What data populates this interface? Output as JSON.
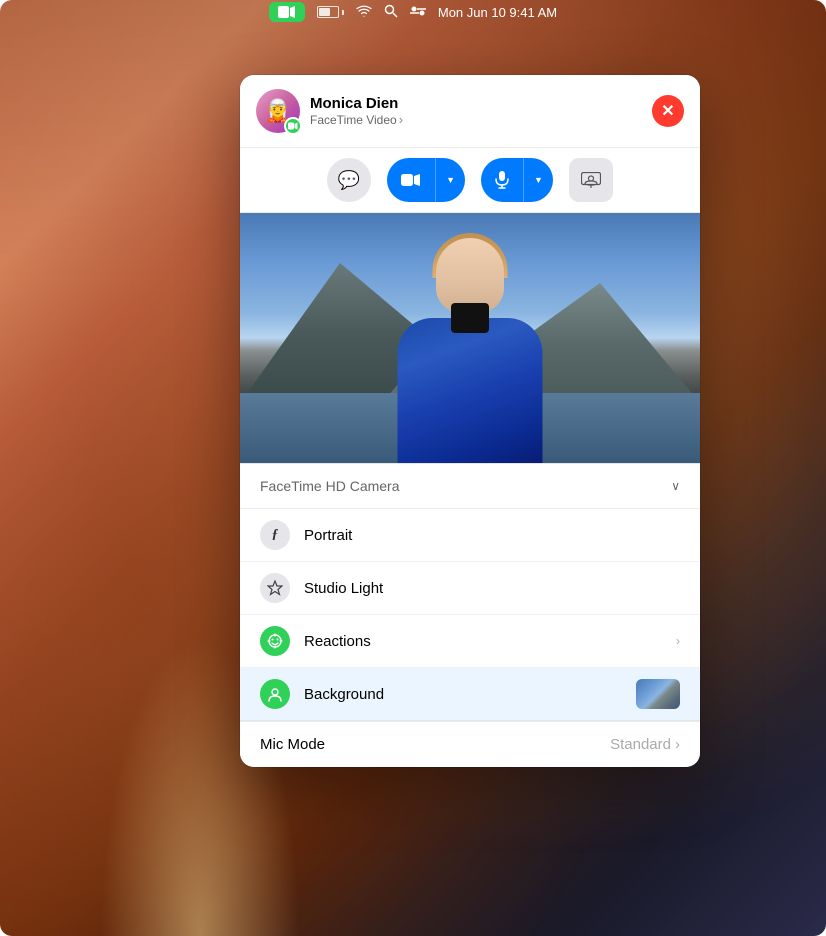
{
  "desktop": {
    "bg_description": "macOS Monterey warm gradient desktop background"
  },
  "menubar": {
    "time": "Mon Jun 10  9:41 AM",
    "facetime_icon": "▶",
    "wifi_icon": "wifi",
    "search_icon": "search",
    "control_icon": "control-center"
  },
  "facetime_window": {
    "caller_name": "Monica Dien",
    "caller_subtitle": "FaceTime Video",
    "caller_subtitle_chevron": "›",
    "avatar_emoji": "🧝",
    "close_label": "×",
    "controls": {
      "message_icon": "💬",
      "video_icon": "📹",
      "mic_icon": "🎤",
      "screen_icon": "👤",
      "chevron_down": "∨"
    },
    "camera_section": {
      "label": "FaceTime HD Camera",
      "chevron": "∨"
    },
    "menu_items": [
      {
        "id": "portrait",
        "icon": "ƒ",
        "icon_style": "gray",
        "label": "Portrait",
        "has_chevron": false,
        "has_thumbnail": false
      },
      {
        "id": "studio-light",
        "icon": "⬡",
        "icon_style": "gray",
        "label": "Studio Light",
        "has_chevron": false,
        "has_thumbnail": false
      },
      {
        "id": "reactions",
        "icon": "⊕",
        "icon_style": "green",
        "label": "Reactions",
        "has_chevron": true,
        "has_thumbnail": false
      },
      {
        "id": "background",
        "icon": "👤",
        "icon_style": "green",
        "label": "Background",
        "has_chevron": false,
        "has_thumbnail": true,
        "highlighted": true
      }
    ],
    "mic_mode": {
      "label": "Mic Mode",
      "value": "Standard",
      "chevron": "›"
    }
  }
}
